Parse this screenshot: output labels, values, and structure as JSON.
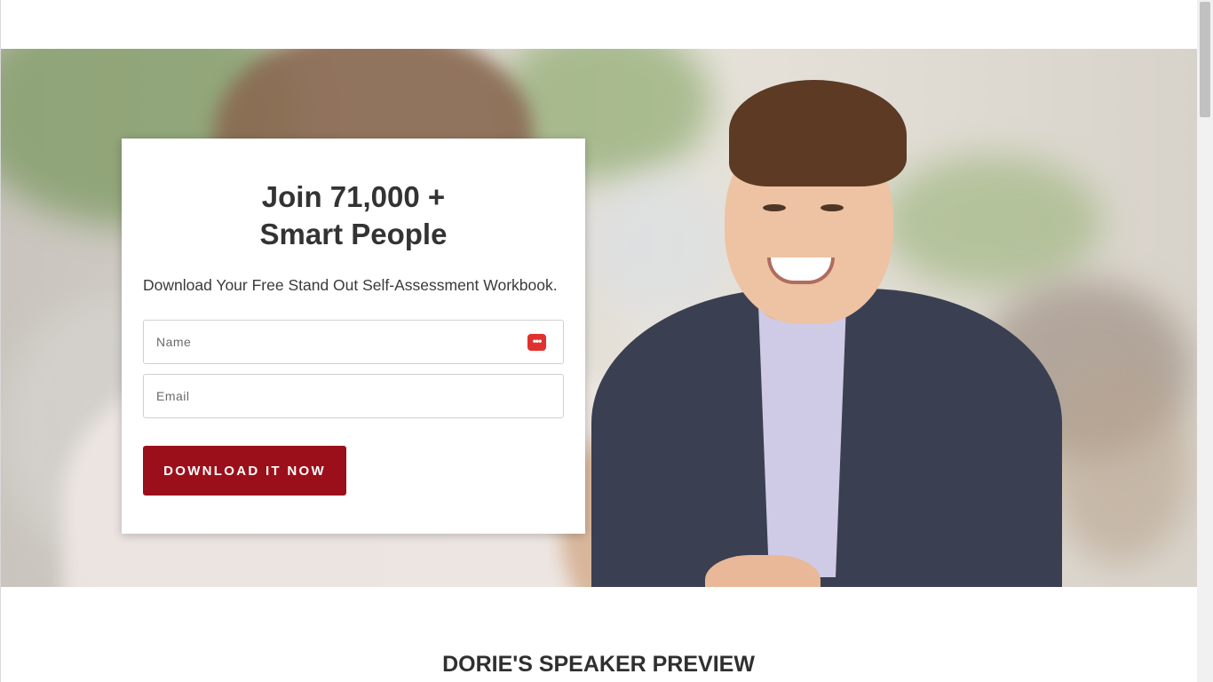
{
  "signup_card": {
    "title_line1": "Join 71,000 +",
    "title_line2": "Smart People",
    "subtitle": "Download Your Free Stand Out Self-Assessment Workbook.",
    "name_placeholder": "Name",
    "email_placeholder": "Email",
    "password_manager_icon": "•••",
    "cta_label": "DOWNLOAD IT NOW"
  },
  "speaker_section": {
    "title": "DORIE'S SPEAKER PREVIEW"
  },
  "colors": {
    "accent": "#9b0f1b",
    "password_manager_icon": "#e0312e",
    "heading_text": "#333333"
  },
  "icons": {
    "password_manager": "password-manager-icon"
  }
}
